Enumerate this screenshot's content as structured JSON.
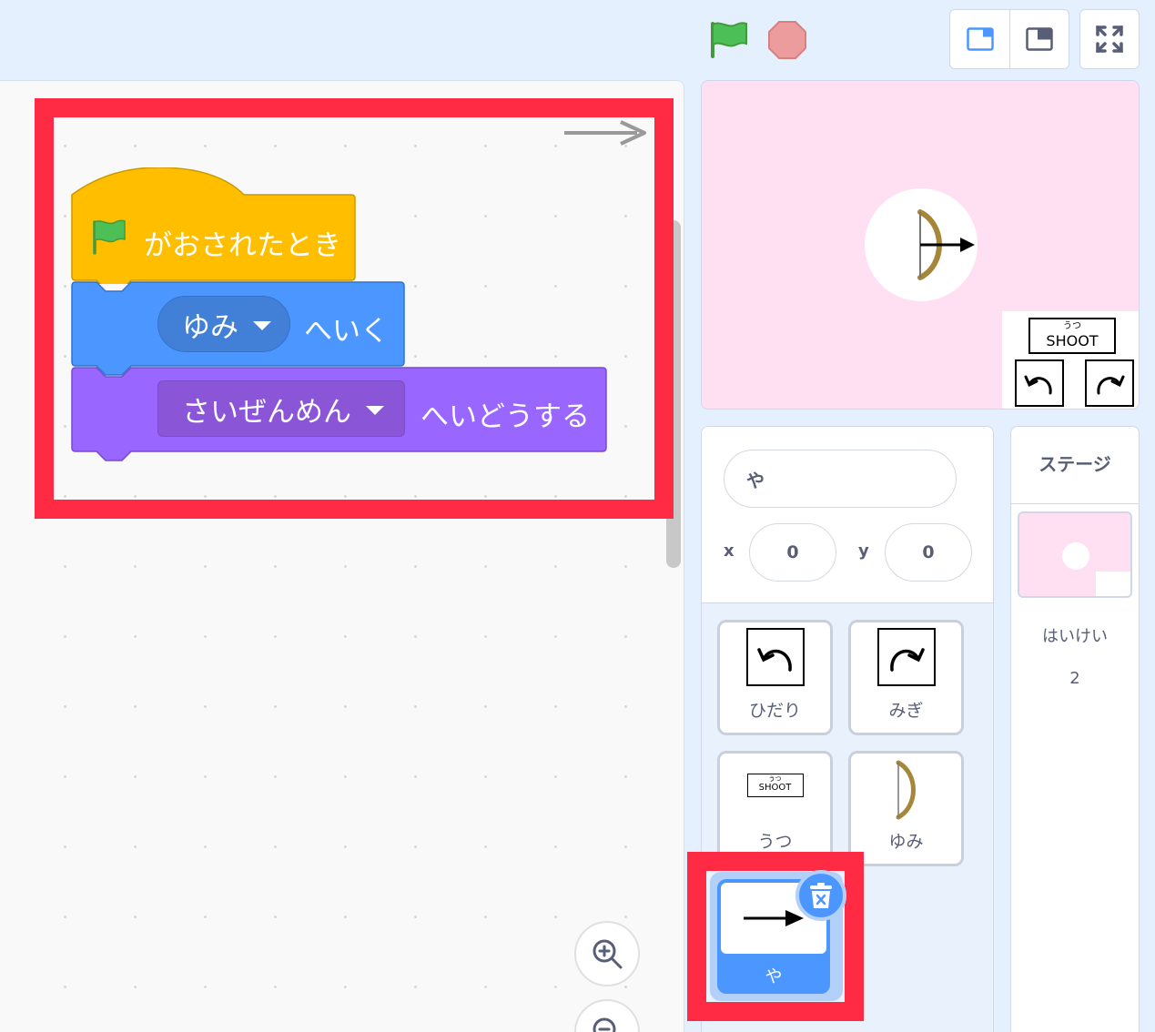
{
  "colors": {
    "events": "#ffbf00",
    "motion": "#4c97ff",
    "looks": "#9966ff",
    "highlight": "#ff2b44",
    "stage_background": "#ffe0f3"
  },
  "toolbar": {
    "green_flag_icon": "green-flag-icon",
    "stop_icon": "stop-icon",
    "small_stage_icon": "small-stage-icon",
    "large_stage_icon": "large-stage-icon",
    "fullscreen_icon": "fullscreen-icon"
  },
  "script": {
    "hat_label": "がおされたとき",
    "goto_target": "ゆみ",
    "goto_suffix": "へいく",
    "layer_target": "さいぜんめん",
    "layer_suffix": "へいどうする"
  },
  "stage": {
    "shoot_ruby": "うつ",
    "shoot_label": "SHOOT"
  },
  "sprite_info": {
    "name": "や",
    "x_label": "x",
    "x_value": "0",
    "y_label": "y",
    "y_value": "0"
  },
  "sprites": [
    {
      "name": "ひだり"
    },
    {
      "name": "みぎ"
    },
    {
      "name": "うつ"
    },
    {
      "name": "ゆみ"
    }
  ],
  "selected_sprite": {
    "name": "や"
  },
  "stage_pane": {
    "title": "ステージ",
    "backdrop_label": "はいけい",
    "backdrop_count": "2"
  }
}
